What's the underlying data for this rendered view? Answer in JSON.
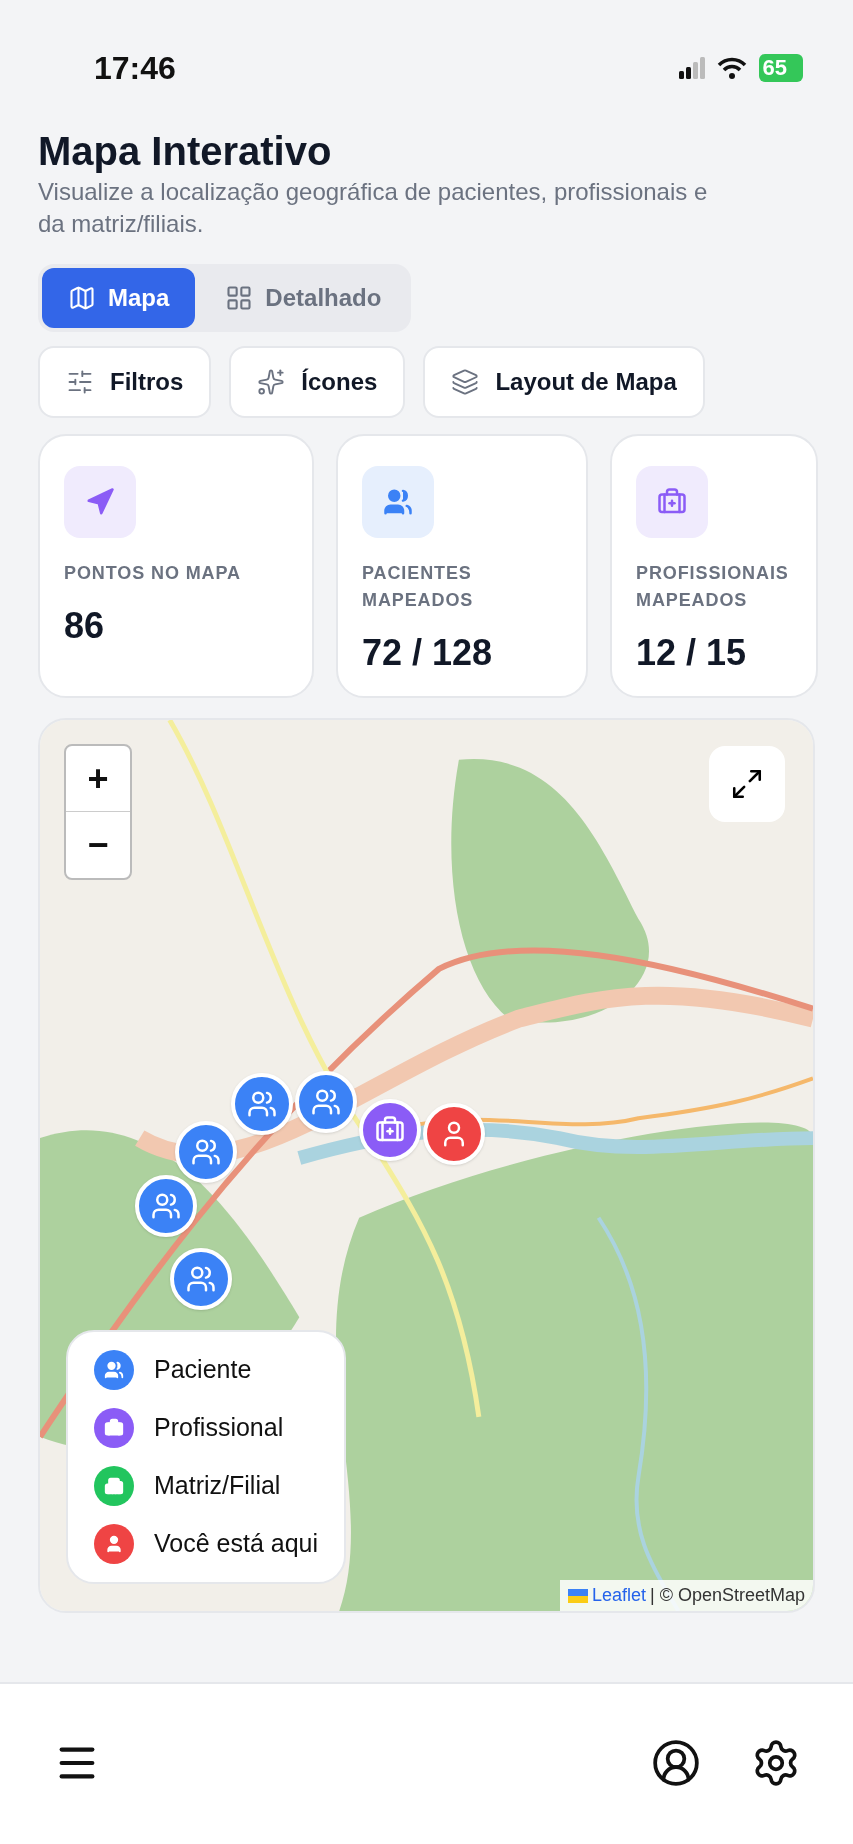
{
  "status_bar": {
    "time": "17:46",
    "battery": "65"
  },
  "header": {
    "title": "Mapa Interativo",
    "subtitle": "Visualize a localização geográfica de pacientes, profissionais e da matriz/filiais."
  },
  "tabs": [
    {
      "label": "Mapa",
      "kind": "map",
      "selected": true
    },
    {
      "label": "Detalhado",
      "kind": "grid",
      "selected": false
    }
  ],
  "actions": [
    {
      "label": "Filtros",
      "kind": "filters"
    },
    {
      "label": "Ícones",
      "kind": "icons"
    },
    {
      "label": "Layout de Mapa",
      "kind": "layers"
    }
  ],
  "stats": [
    {
      "label": "PONTOS NO MAPA",
      "value": "86",
      "kind": "points"
    },
    {
      "label": "PACIENTES MAPEADOS",
      "value": "72 / 128",
      "kind": "patients"
    },
    {
      "label": "PROFISSIONAIS MAPEADOS",
      "value": "12 / 15",
      "kind": "professionals"
    }
  ],
  "map": {
    "zoom_in": "+",
    "zoom_out": "−",
    "markers": [
      {
        "kind": "patient"
      },
      {
        "kind": "patient"
      },
      {
        "kind": "patient"
      },
      {
        "kind": "patient"
      },
      {
        "kind": "patient"
      },
      {
        "kind": "professional"
      },
      {
        "kind": "you"
      }
    ],
    "legend": [
      {
        "label": "Paciente",
        "kind": "patient",
        "color": "#3b82f6"
      },
      {
        "label": "Profissional",
        "kind": "professional",
        "color": "#8b5cf6"
      },
      {
        "label": "Matriz/Filial",
        "kind": "branch",
        "color": "#22c55e"
      },
      {
        "label": "Você está aqui",
        "kind": "you",
        "color": "#ef4444"
      }
    ],
    "attribution": {
      "link": "Leaflet",
      "text": "| © OpenStreetMap"
    }
  },
  "bottom_nav": [
    {
      "kind": "menu"
    },
    {
      "kind": "profile"
    },
    {
      "kind": "settings"
    }
  ]
}
